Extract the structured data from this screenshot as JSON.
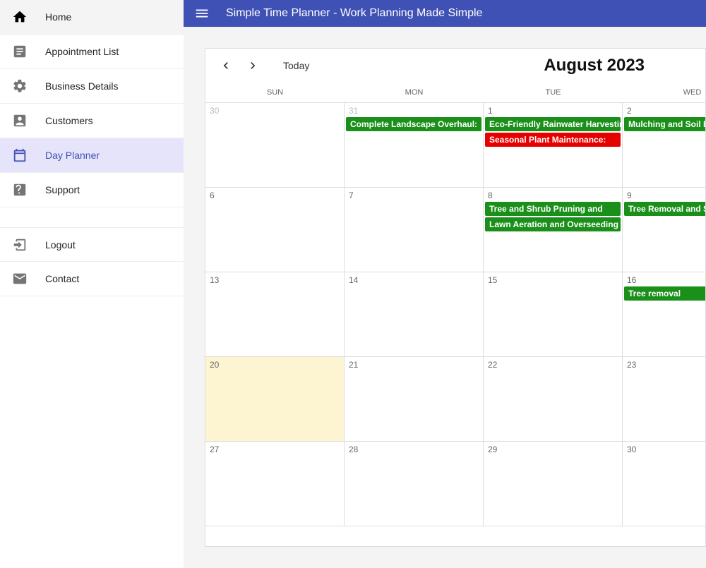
{
  "appbar": {
    "title": "Simple Time Planner - Work Planning Made Simple"
  },
  "sidebar": {
    "items": [
      {
        "label": "Home"
      },
      {
        "label": "Appointment List"
      },
      {
        "label": "Business Details"
      },
      {
        "label": "Customers"
      },
      {
        "label": "Day Planner"
      },
      {
        "label": "Support"
      },
      {
        "label": "Logout"
      },
      {
        "label": "Contact"
      }
    ]
  },
  "calendar": {
    "today_label": "Today",
    "title": "August 2023",
    "day_headers": [
      "SUN",
      "MON",
      "TUE",
      "WED"
    ],
    "weeks": [
      {
        "cells": [
          {
            "num": "30",
            "othermonth": true,
            "events": []
          },
          {
            "num": "31",
            "othermonth": true,
            "events": [
              {
                "label": "Complete Landscape Overhaul:",
                "color": "green"
              }
            ]
          },
          {
            "num": "1",
            "events": [
              {
                "label": "Eco-Friendly Rainwater Harvesting",
                "color": "green"
              },
              {
                "label": "Seasonal Plant Maintenance:",
                "color": "red"
              }
            ]
          },
          {
            "num": "2",
            "events": [
              {
                "label": "Mulching and Soil Enrichment",
                "color": "green"
              }
            ]
          }
        ]
      },
      {
        "cells": [
          {
            "num": "6",
            "events": []
          },
          {
            "num": "7",
            "events": []
          },
          {
            "num": "8",
            "events": [
              {
                "label": "Tree and Shrub Pruning and",
                "color": "green"
              },
              {
                "label": "Lawn Aeration and Overseeding",
                "color": "green"
              }
            ]
          },
          {
            "num": "9",
            "events": [
              {
                "label": "Tree Removal and Stump",
                "color": "green"
              }
            ]
          }
        ]
      },
      {
        "cells": [
          {
            "num": "13",
            "events": []
          },
          {
            "num": "14",
            "events": []
          },
          {
            "num": "15",
            "events": []
          },
          {
            "num": "16",
            "events": [
              {
                "label": "Tree removal",
                "color": "green"
              }
            ]
          }
        ]
      },
      {
        "cells": [
          {
            "num": "20",
            "today": true,
            "events": []
          },
          {
            "num": "21",
            "events": []
          },
          {
            "num": "22",
            "events": []
          },
          {
            "num": "23",
            "events": []
          }
        ]
      },
      {
        "cells": [
          {
            "num": "27",
            "events": []
          },
          {
            "num": "28",
            "events": []
          },
          {
            "num": "29",
            "events": []
          },
          {
            "num": "30",
            "events": []
          }
        ]
      }
    ]
  }
}
